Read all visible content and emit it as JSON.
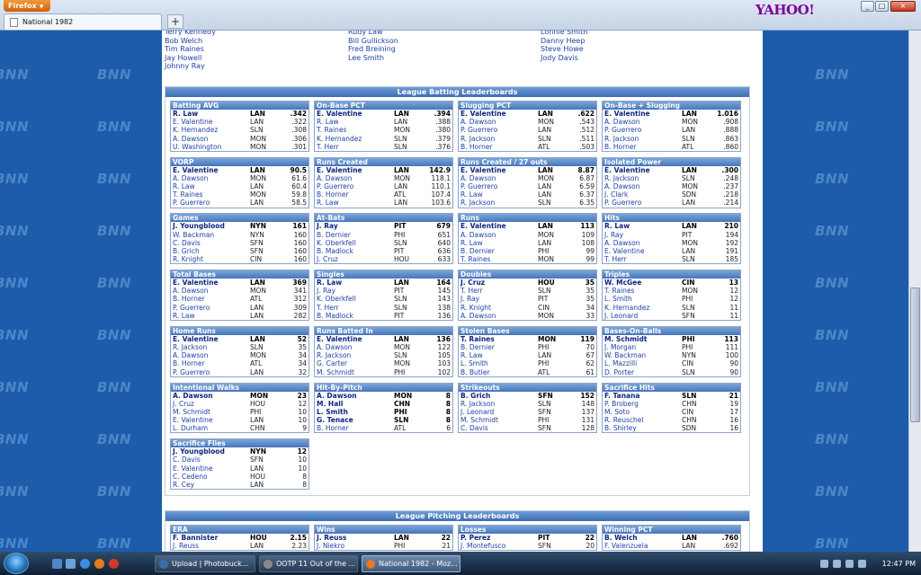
{
  "browser": {
    "menu_button": "Firefox",
    "tab_title": "National 1982",
    "new_tab": "+",
    "brand": "YAHOO!",
    "window_controls": {
      "minimize": "_",
      "maximize": "□",
      "close": "×"
    }
  },
  "background_watermark": "BNN",
  "player_list": [
    [
      "Terry Kennedy",
      "Bob Welch",
      "Tim Raines",
      "Jay Howell",
      "Johnny Ray"
    ],
    [
      "Rudy Law",
      "Bill Gullickson",
      "Fred Breining",
      "Lee Smith"
    ],
    [
      "Lonnie Smith",
      "Danny Heep",
      "Steve Howe",
      "Jody Davis"
    ]
  ],
  "batting_section_title": "League Batting Leaderboards",
  "pitching_section_title": "League Pitching Leaderboards",
  "batting_boards": [
    {
      "title": "Batting AVG",
      "rows": [
        [
          "R. Law",
          "LAN",
          ".342"
        ],
        [
          "E. Valentine",
          "LAN",
          ".322"
        ],
        [
          "K. Hernandez",
          "SLN",
          ".308"
        ],
        [
          "A. Dawson",
          "MON",
          ".306"
        ],
        [
          "U. Washington",
          "MON",
          ".301"
        ]
      ]
    },
    {
      "title": "On-Base PCT",
      "rows": [
        [
          "E. Valentine",
          "LAN",
          ".394"
        ],
        [
          "R. Law",
          "LAN",
          ".388"
        ],
        [
          "T. Raines",
          "MON",
          ".380"
        ],
        [
          "K. Hernandez",
          "SLN",
          ".379"
        ],
        [
          "T. Herr",
          "SLN",
          ".376"
        ]
      ]
    },
    {
      "title": "Slugging PCT",
      "rows": [
        [
          "E. Valentine",
          "LAN",
          ".622"
        ],
        [
          "A. Dawson",
          "MON",
          ".543"
        ],
        [
          "P. Guerrero",
          "LAN",
          ".512"
        ],
        [
          "R. Jackson",
          "SLN",
          ".511"
        ],
        [
          "B. Horner",
          "ATL",
          ".503"
        ]
      ]
    },
    {
      "title": "On-Base + Slugging",
      "rows": [
        [
          "E. Valentine",
          "LAN",
          "1.016"
        ],
        [
          "A. Dawson",
          "MON",
          ".908"
        ],
        [
          "P. Guerrero",
          "LAN",
          ".888"
        ],
        [
          "R. Jackson",
          "SLN",
          ".863"
        ],
        [
          "B. Horner",
          "ATL",
          ".860"
        ]
      ]
    },
    {
      "title": "VORP",
      "rows": [
        [
          "E. Valentine",
          "LAN",
          "90.5"
        ],
        [
          "A. Dawson",
          "MON",
          "61.6"
        ],
        [
          "R. Law",
          "LAN",
          "60.4"
        ],
        [
          "T. Raines",
          "MON",
          "59.8"
        ],
        [
          "P. Guerrero",
          "LAN",
          "58.5"
        ]
      ]
    },
    {
      "title": "Runs Created",
      "rows": [
        [
          "E. Valentine",
          "LAN",
          "142.9"
        ],
        [
          "A. Dawson",
          "MON",
          "118.1"
        ],
        [
          "P. Guerrero",
          "LAN",
          "110.1"
        ],
        [
          "B. Horner",
          "ATL",
          "107.4"
        ],
        [
          "R. Law",
          "LAN",
          "103.6"
        ]
      ]
    },
    {
      "title": "Runs Created / 27 outs",
      "rows": [
        [
          "E. Valentine",
          "LAN",
          "8.87"
        ],
        [
          "A. Dawson",
          "MON",
          "6.87"
        ],
        [
          "P. Guerrero",
          "LAN",
          "6.59"
        ],
        [
          "R. Law",
          "LAN",
          "6.37"
        ],
        [
          "R. Jackson",
          "SLN",
          "6.35"
        ]
      ]
    },
    {
      "title": "Isolated Power",
      "rows": [
        [
          "E. Valentine",
          "LAN",
          ".300"
        ],
        [
          "R. Jackson",
          "SLN",
          ".248"
        ],
        [
          "A. Dawson",
          "MON",
          ".237"
        ],
        [
          "J. Clark",
          "SDN",
          ".218"
        ],
        [
          "P. Guerrero",
          "LAN",
          ".214"
        ]
      ]
    },
    {
      "title": "Games",
      "rows": [
        [
          "J. Youngblood",
          "NYN",
          "161"
        ],
        [
          "W. Backman",
          "NYN",
          "160"
        ],
        [
          "C. Davis",
          "SFN",
          "160"
        ],
        [
          "B. Grich",
          "SFN",
          "160"
        ],
        [
          "R. Knight",
          "CIN",
          "160"
        ]
      ]
    },
    {
      "title": "At-Bats",
      "rows": [
        [
          "J. Ray",
          "PIT",
          "679"
        ],
        [
          "B. Dernier",
          "PHI",
          "651"
        ],
        [
          "K. Oberkfell",
          "SLN",
          "640"
        ],
        [
          "B. Madlock",
          "PIT",
          "636"
        ],
        [
          "J. Cruz",
          "HOU",
          "633"
        ]
      ]
    },
    {
      "title": "Runs",
      "rows": [
        [
          "E. Valentine",
          "LAN",
          "113"
        ],
        [
          "A. Dawson",
          "MON",
          "109"
        ],
        [
          "R. Law",
          "LAN",
          "108"
        ],
        [
          "B. Dernier",
          "PHI",
          "99"
        ],
        [
          "T. Raines",
          "MON",
          "99"
        ]
      ]
    },
    {
      "title": "Hits",
      "rows": [
        [
          "R. Law",
          "LAN",
          "210"
        ],
        [
          "J. Ray",
          "PIT",
          "194"
        ],
        [
          "A. Dawson",
          "MON",
          "192"
        ],
        [
          "E. Valentine",
          "LAN",
          "191"
        ],
        [
          "T. Herr",
          "SLN",
          "185"
        ]
      ]
    },
    {
      "title": "Total Bases",
      "rows": [
        [
          "E. Valentine",
          "LAN",
          "369"
        ],
        [
          "A. Dawson",
          "MON",
          "341"
        ],
        [
          "B. Horner",
          "ATL",
          "312"
        ],
        [
          "P. Guerrero",
          "LAN",
          "309"
        ],
        [
          "R. Law",
          "LAN",
          "282"
        ]
      ]
    },
    {
      "title": "Singles",
      "rows": [
        [
          "R. Law",
          "LAN",
          "164"
        ],
        [
          "J. Ray",
          "PIT",
          "145"
        ],
        [
          "K. Oberkfell",
          "SLN",
          "143"
        ],
        [
          "T. Herr",
          "SLN",
          "138"
        ],
        [
          "B. Madlock",
          "PIT",
          "136"
        ]
      ]
    },
    {
      "title": "Doubles",
      "rows": [
        [
          "J. Cruz",
          "HOU",
          "35"
        ],
        [
          "T. Herr",
          "SLN",
          "35"
        ],
        [
          "J. Ray",
          "PIT",
          "35"
        ],
        [
          "R. Knight",
          "CIN",
          "34"
        ],
        [
          "A. Dawson",
          "MON",
          "33"
        ]
      ]
    },
    {
      "title": "Triples",
      "rows": [
        [
          "W. McGee",
          "CIN",
          "13"
        ],
        [
          "T. Raines",
          "MON",
          "12"
        ],
        [
          "L. Smith",
          "PHI",
          "12"
        ],
        [
          "K. Hernandez",
          "SLN",
          "11"
        ],
        [
          "J. Leonard",
          "SFN",
          "11"
        ]
      ]
    },
    {
      "title": "Home Runs",
      "rows": [
        [
          "E. Valentine",
          "LAN",
          "52"
        ],
        [
          "R. Jackson",
          "SLN",
          "35"
        ],
        [
          "A. Dawson",
          "MON",
          "34"
        ],
        [
          "B. Horner",
          "ATL",
          "34"
        ],
        [
          "P. Guerrero",
          "LAN",
          "32"
        ]
      ]
    },
    {
      "title": "Runs Batted In",
      "rows": [
        [
          "E. Valentine",
          "LAN",
          "136"
        ],
        [
          "A. Dawson",
          "MON",
          "122"
        ],
        [
          "R. Jackson",
          "SLN",
          "105"
        ],
        [
          "G. Carter",
          "MON",
          "103"
        ],
        [
          "M. Schmidt",
          "PHI",
          "102"
        ]
      ]
    },
    {
      "title": "Stolen Bases",
      "rows": [
        [
          "T. Raines",
          "MON",
          "119"
        ],
        [
          "B. Dernier",
          "PHI",
          "70"
        ],
        [
          "R. Law",
          "LAN",
          "67"
        ],
        [
          "L. Smith",
          "PHI",
          "62"
        ],
        [
          "B. Butler",
          "ATL",
          "61"
        ]
      ]
    },
    {
      "title": "Bases-On-Balls",
      "rows": [
        [
          "M. Schmidt",
          "PHI",
          "113"
        ],
        [
          "J. Morgan",
          "PHI",
          "111"
        ],
        [
          "W. Backman",
          "NYN",
          "100"
        ],
        [
          "L. Mazzilli",
          "CIN",
          "90"
        ],
        [
          "D. Porter",
          "SLN",
          "90"
        ]
      ]
    },
    {
      "title": "Intentional Walks",
      "rows": [
        [
          "A. Dawson",
          "MON",
          "23"
        ],
        [
          "J. Cruz",
          "HOU",
          "12"
        ],
        [
          "M. Schmidt",
          "PHI",
          "10"
        ],
        [
          "E. Valentine",
          "LAN",
          "10"
        ],
        [
          "L. Durham",
          "CHN",
          "9"
        ]
      ]
    },
    {
      "title": "Hit-By-Pitch",
      "lead_count": 4,
      "rows": [
        [
          "A. Dawson",
          "MON",
          "8"
        ],
        [
          "M. Hall",
          "CHN",
          "8"
        ],
        [
          "L. Smith",
          "PHI",
          "8"
        ],
        [
          "G. Tenace",
          "SLN",
          "8"
        ],
        [
          "B. Horner",
          "ATL",
          "6"
        ]
      ]
    },
    {
      "title": "Strikeouts",
      "rows": [
        [
          "B. Grich",
          "SFN",
          "152"
        ],
        [
          "R. Jackson",
          "SLN",
          "148"
        ],
        [
          "J. Leonard",
          "SFN",
          "137"
        ],
        [
          "M. Schmidt",
          "PHI",
          "131"
        ],
        [
          "C. Davis",
          "SFN",
          "128"
        ]
      ]
    },
    {
      "title": "Sacrifice Hits",
      "rows": [
        [
          "F. Tanana",
          "SLN",
          "21"
        ],
        [
          "P. Broberg",
          "CHN",
          "19"
        ],
        [
          "M. Soto",
          "CIN",
          "17"
        ],
        [
          "R. Reuschel",
          "CHN",
          "16"
        ],
        [
          "B. Shirley",
          "SDN",
          "16"
        ]
      ]
    },
    {
      "title": "Sacrifice Flies",
      "rows": [
        [
          "J. Youngblood",
          "NYN",
          "12"
        ],
        [
          "C. Davis",
          "SFN",
          "10"
        ],
        [
          "E. Valentine",
          "LAN",
          "10"
        ],
        [
          "C. Cedeno",
          "HOU",
          "8"
        ],
        [
          "R. Cey",
          "LAN",
          "8"
        ]
      ]
    }
  ],
  "pitching_boards": [
    {
      "title": "ERA",
      "rows": [
        [
          "F. Bannister",
          "HOU",
          "2.15"
        ],
        [
          "J. Reuss",
          "LAN",
          "2.23"
        ]
      ]
    },
    {
      "title": "Wins",
      "rows": [
        [
          "J. Reuss",
          "LAN",
          "22"
        ],
        [
          "J. Niekro",
          "PHI",
          "21"
        ]
      ]
    },
    {
      "title": "Losses",
      "rows": [
        [
          "P. Perez",
          "PIT",
          "22"
        ],
        [
          "J. Montefusco",
          "SFN",
          "20"
        ]
      ]
    },
    {
      "title": "Winning PCT",
      "rows": [
        [
          "B. Welch",
          "LAN",
          ".760"
        ],
        [
          "F. Valenzuela",
          "LAN",
          ".692"
        ]
      ]
    }
  ],
  "taskbar": {
    "tasks": [
      "Upload | Photobuck...",
      "OOTP 11 Out of the ...",
      "National 1982 - Moz..."
    ],
    "active_index": 2,
    "clock": "12:47 PM"
  },
  "colors": {
    "accent": "#3c6cb4",
    "link": "#1f3fa8",
    "background": "#1c5cab"
  }
}
